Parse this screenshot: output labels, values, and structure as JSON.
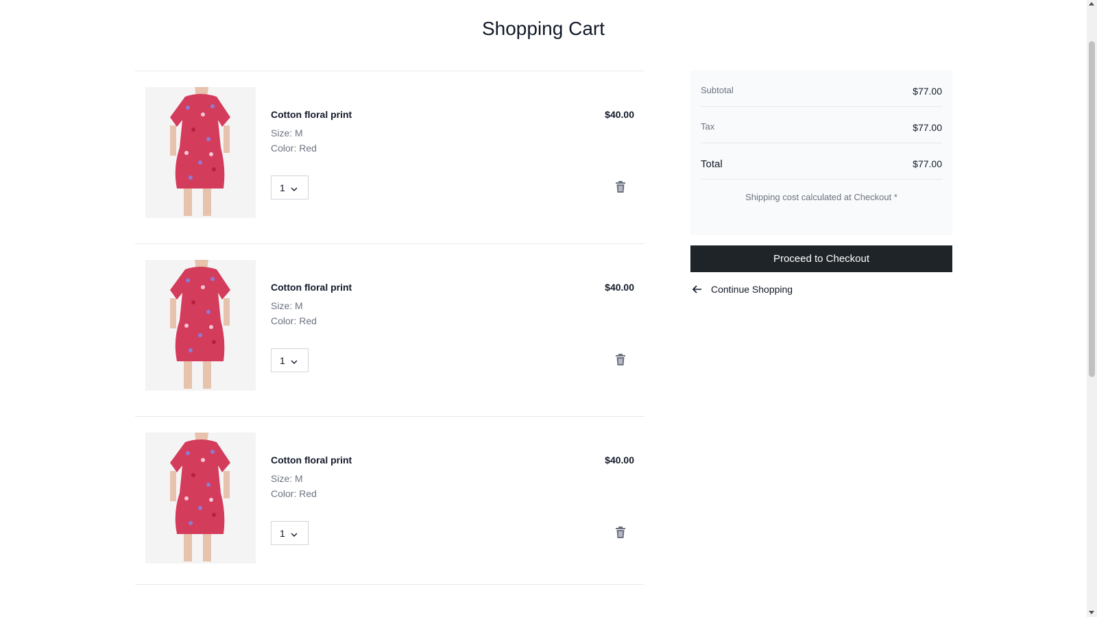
{
  "page": {
    "title": "Shopping Cart"
  },
  "cart": {
    "items": [
      {
        "name": "Cotton floral print",
        "price": "$40.00",
        "size": "Size: M",
        "color": "Color: Red",
        "quantity": "1",
        "image": "floral-dress-photo"
      },
      {
        "name": "Cotton floral print",
        "price": "$40.00",
        "size": "Size: M",
        "color": "Color: Red",
        "quantity": "1",
        "image": "floral-dress-photo"
      },
      {
        "name": "Cotton floral print",
        "price": "$40.00",
        "size": "Size: M",
        "color": "Color: Red",
        "quantity": "1",
        "image": "floral-dress-photo"
      }
    ]
  },
  "summary": {
    "subtotal_label": "Subtotal",
    "subtotal_value": "$77.00",
    "tax_label": "Tax",
    "tax_value": "$77.00",
    "total_label": "Total",
    "total_value": "$77.00",
    "shipping_note": "Shipping cost calculated at Checkout *"
  },
  "actions": {
    "checkout_label": "Proceed to Checkout",
    "continue_label": "Continue Shopping"
  },
  "icons": {
    "delete": "trash-icon",
    "quantity": "chevron-down-icon",
    "back": "arrow-left-icon"
  },
  "colors": {
    "checkout_button": "#1f2428",
    "summary_background": "#f9fafb",
    "muted_text": "#6b7280",
    "dress_red": "#d43c5c"
  }
}
